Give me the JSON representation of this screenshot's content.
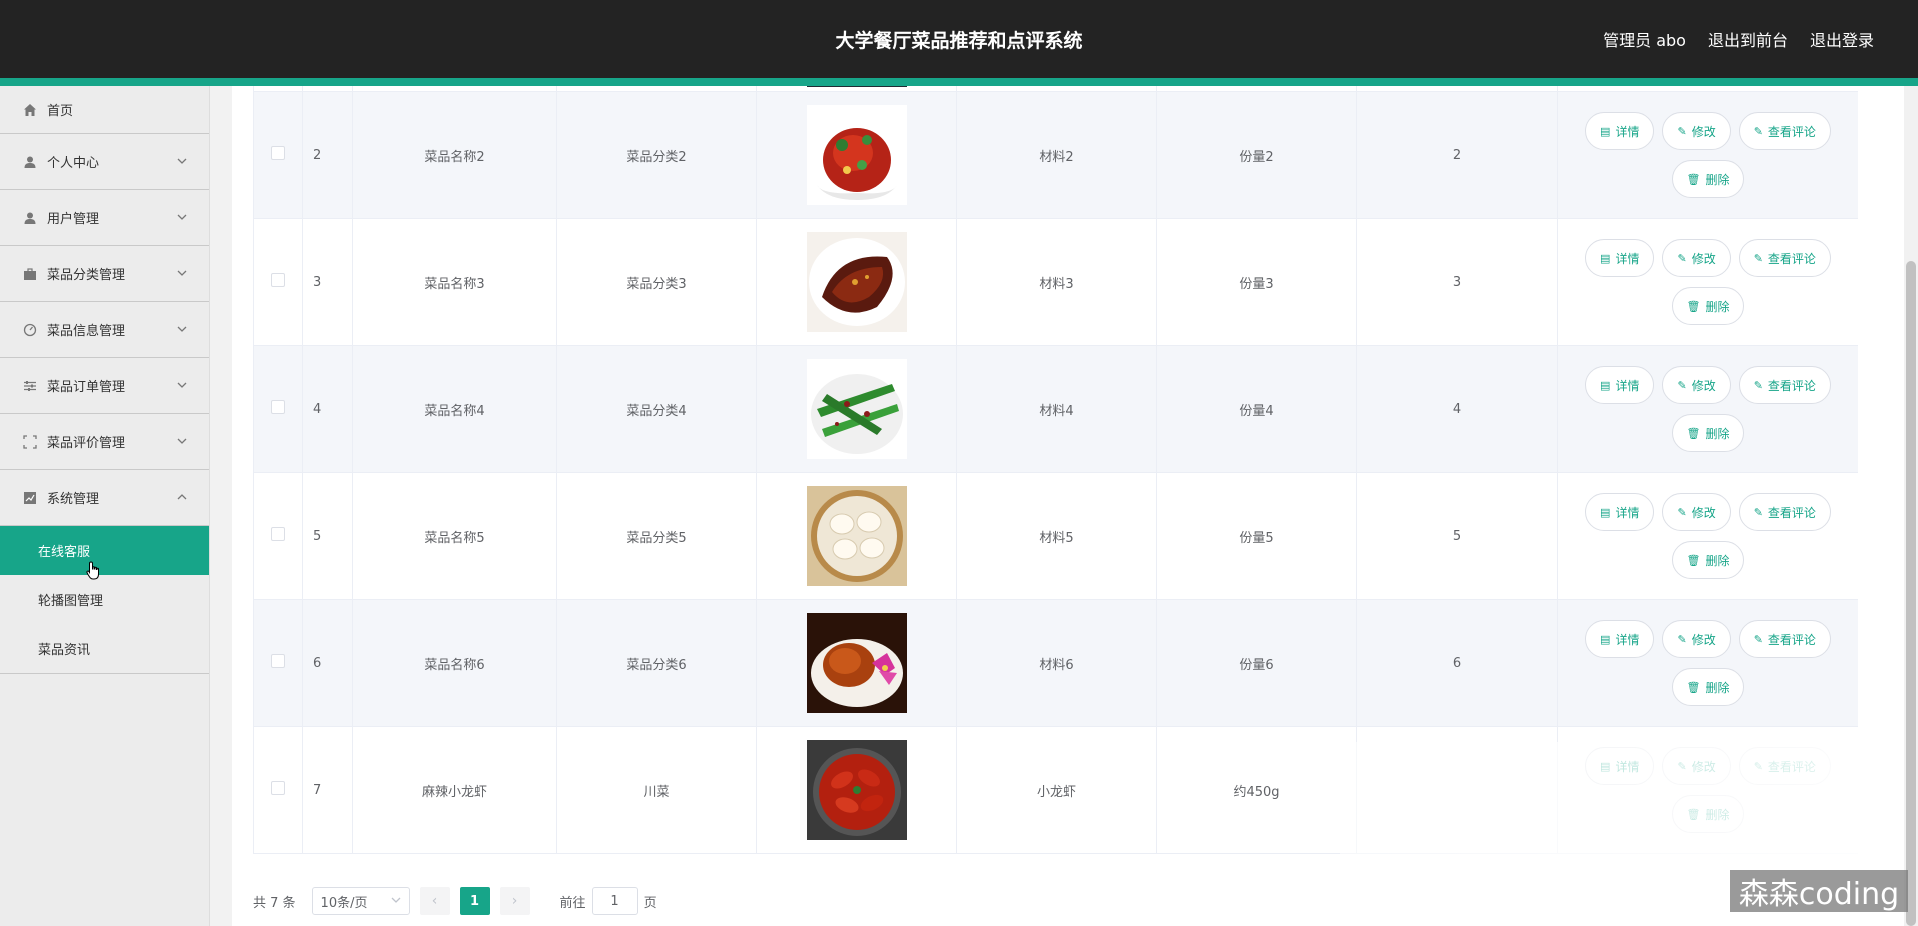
{
  "header": {
    "title": "大学餐厅菜品推荐和点评系统",
    "admin_label": "管理员 abo",
    "to_front": "退出到前台",
    "logout": "退出登录"
  },
  "sidebar": {
    "items": [
      {
        "label": "首页",
        "icon": "home-icon"
      },
      {
        "label": "个人中心",
        "icon": "user-icon"
      },
      {
        "label": "用户管理",
        "icon": "user-icon"
      },
      {
        "label": "菜品分类管理",
        "icon": "briefcase-icon"
      },
      {
        "label": "菜品信息管理",
        "icon": "dashboard-icon"
      },
      {
        "label": "菜品订单管理",
        "icon": "sliders-icon"
      },
      {
        "label": "菜品评价管理",
        "icon": "fullscreen-icon"
      },
      {
        "label": "系统管理",
        "icon": "chart-icon"
      }
    ],
    "sub_items": [
      {
        "label": "在线客服",
        "active": true
      },
      {
        "label": "轮播图管理",
        "active": false
      },
      {
        "label": "菜品资讯",
        "active": false
      }
    ]
  },
  "table": {
    "rows": [
      {
        "index": "2",
        "name": "菜品名称2",
        "category": "菜品分类2",
        "material": "材料2",
        "portion": "份量2",
        "count": "2"
      },
      {
        "index": "3",
        "name": "菜品名称3",
        "category": "菜品分类3",
        "material": "材料3",
        "portion": "份量3",
        "count": "3"
      },
      {
        "index": "4",
        "name": "菜品名称4",
        "category": "菜品分类4",
        "material": "材料4",
        "portion": "份量4",
        "count": "4"
      },
      {
        "index": "5",
        "name": "菜品名称5",
        "category": "菜品分类5",
        "material": "材料5",
        "portion": "份量5",
        "count": "5"
      },
      {
        "index": "6",
        "name": "菜品名称6",
        "category": "菜品分类6",
        "material": "材料6",
        "portion": "份量6",
        "count": "6"
      },
      {
        "index": "7",
        "name": "麻辣小龙虾",
        "category": "川菜",
        "material": "小龙虾",
        "portion": "约450g",
        "count": ""
      }
    ],
    "actions": {
      "detail": "详情",
      "edit": "修改",
      "comments": "查看评论",
      "delete": "删除"
    }
  },
  "pager": {
    "total": "共 7 条",
    "page_size": "10条/页",
    "current_page": "1",
    "goto_prefix": "前往",
    "goto_value": "1",
    "goto_suffix": "页"
  },
  "watermark": "森森coding",
  "colors": {
    "accent": "#17a589",
    "header_bg": "#232323"
  }
}
